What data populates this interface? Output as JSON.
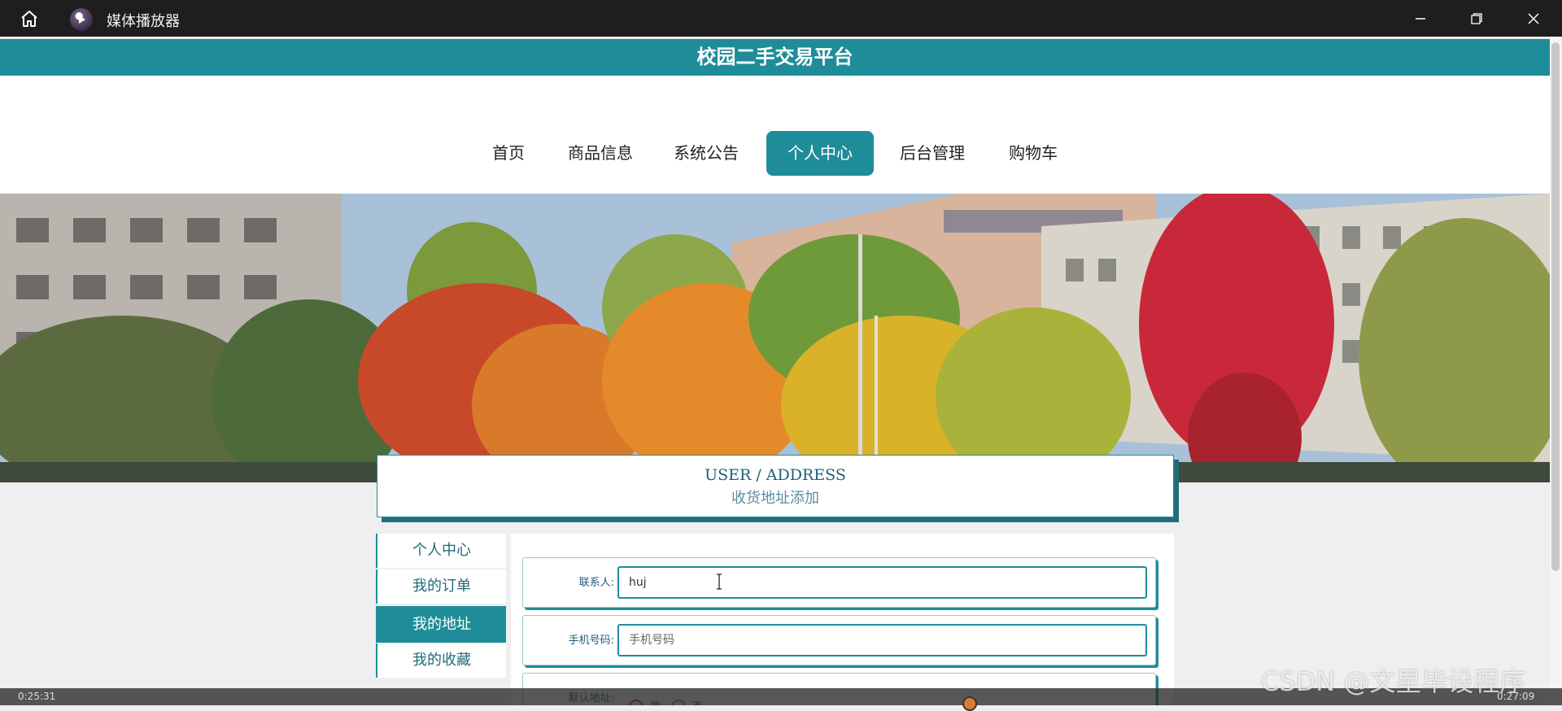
{
  "window": {
    "app_title": "媒体播放器",
    "controls": [
      "minimize",
      "maximize",
      "close"
    ]
  },
  "site": {
    "title": "校园二手交易平台",
    "accent_color": "#1f8d99"
  },
  "nav": {
    "items": [
      {
        "label": "首页",
        "active": false
      },
      {
        "label": "商品信息",
        "active": false
      },
      {
        "label": "系统公告",
        "active": false
      },
      {
        "label": "个人中心",
        "active": true
      },
      {
        "label": "后台管理",
        "active": false
      },
      {
        "label": "购物车",
        "active": false
      }
    ]
  },
  "banner": {
    "description_icon": "campus-photo"
  },
  "heading": {
    "english": "USER / ADDRESS",
    "chinese": "收货地址添加"
  },
  "sidebar": {
    "items": [
      {
        "label": "个人中心",
        "active": false
      },
      {
        "label": "我的订单",
        "active": false
      },
      {
        "label": "我的地址",
        "active": true
      },
      {
        "label": "我的收藏",
        "active": false
      }
    ]
  },
  "form": {
    "contact_label": "联系人:",
    "contact_value": "huj",
    "phone_label": "手机号码:",
    "phone_placeholder": "手机号码",
    "default_label": "默认地址:",
    "default_yes": "是",
    "default_no": "否"
  },
  "player": {
    "current_time": "0:25:31",
    "total_time": "0:27:09"
  },
  "watermark": "CSDN @文星毕设程序"
}
